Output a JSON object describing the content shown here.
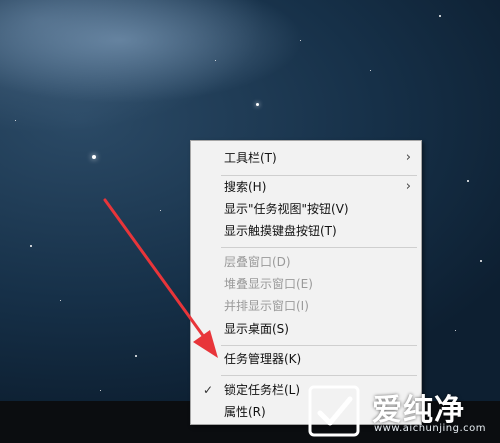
{
  "context_menu": {
    "items": [
      {
        "label": "工具栏(T)",
        "submenu": true,
        "disabled": false,
        "checked": false
      },
      {
        "label": "搜索(H)",
        "submenu": true,
        "disabled": false,
        "checked": false
      },
      {
        "label": "显示\"任务视图\"按钮(V)",
        "submenu": false,
        "disabled": false,
        "checked": false
      },
      {
        "label": "显示触摸键盘按钮(T)",
        "submenu": false,
        "disabled": false,
        "checked": false
      },
      {
        "label": "层叠窗口(D)",
        "submenu": false,
        "disabled": true,
        "checked": false
      },
      {
        "label": "堆叠显示窗口(E)",
        "submenu": false,
        "disabled": true,
        "checked": false
      },
      {
        "label": "并排显示窗口(I)",
        "submenu": false,
        "disabled": true,
        "checked": false
      },
      {
        "label": "显示桌面(S)",
        "submenu": false,
        "disabled": false,
        "checked": false
      },
      {
        "label": "任务管理器(K)",
        "submenu": false,
        "disabled": false,
        "checked": false
      },
      {
        "label": "锁定任务栏(L)",
        "submenu": false,
        "disabled": false,
        "checked": true
      },
      {
        "label": "属性(R)",
        "submenu": false,
        "disabled": false,
        "checked": false
      }
    ],
    "submenu_arrow": "›",
    "check_mark": "✓"
  },
  "watermark": {
    "title": "爱纯净",
    "url": "www.aichunjing.com"
  },
  "colors": {
    "pointer_arrow": "#e8353a",
    "menu_background": "#f2f2f2",
    "disabled_text": "#9a9a9a"
  }
}
